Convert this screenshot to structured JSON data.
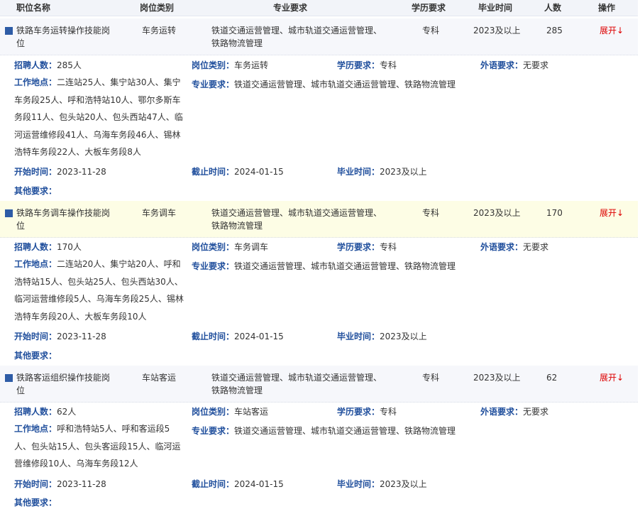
{
  "header": {
    "name": "职位名称",
    "category": "岗位类别",
    "major": "专业要求",
    "education": "学历要求",
    "graduation": "毕业时间",
    "count": "人数",
    "action": "操作"
  },
  "labels": {
    "recruit": "招聘人数",
    "category": "岗位类别",
    "education": "学历要求",
    "language": "外语要求",
    "location": "工作地点",
    "major": "专业要求",
    "start": "开始时间",
    "end": "截止时间",
    "graduation": "毕业时间",
    "other": "其他要求",
    "colon": "："
  },
  "jobs": [
    {
      "name": "铁路车务运转操作技能岗位",
      "category": "车务运转",
      "major_short": "铁道交通运营管理、城市轨道交通运营管理、铁路物流管理",
      "education": "专科",
      "graduation": "2023及以上",
      "count": "285",
      "action": "展开↓",
      "recruit": "285人",
      "language": "无要求",
      "location": "二连站25人、集宁站30人、集宁车务段25人、呼和浩特站10人、鄂尔多斯车务段11人、包头站20人、包头西站47人、临河运营维修段41人、乌海车务段46人、锡林浩特车务段22人、大板车务段8人",
      "major_full": "铁道交通运营管理、城市轨道交通运营管理、铁路物流管理",
      "start": "2023-11-28",
      "end": "2024-01-15",
      "grad_req": "2023及以上",
      "other": ""
    },
    {
      "name": "铁路车务调车操作技能岗位",
      "category": "车务调车",
      "major_short": "铁道交通运营管理、城市轨道交通运营管理、铁路物流管理",
      "education": "专科",
      "graduation": "2023及以上",
      "count": "170",
      "action": "展开↓",
      "recruit": "170人",
      "language": "无要求",
      "location": "二连站20人、集宁站20人、呼和浩特站15人、包头站25人、包头西站30人、临河运营维修段5人、乌海车务段25人、锡林浩特车务段20人、大板车务段10人",
      "major_full": "铁道交通运营管理、城市轨道交通运营管理、铁路物流管理",
      "start": "2023-11-28",
      "end": "2024-01-15",
      "grad_req": "2023及以上",
      "other": ""
    },
    {
      "name": "铁路客运组织操作技能岗位",
      "category": "车站客运",
      "major_short": "铁道交通运营管理、城市轨道交通运营管理、铁路物流管理",
      "education": "专科",
      "graduation": "2023及以上",
      "count": "62",
      "action": "展开↓",
      "recruit": "62人",
      "language": "无要求",
      "location": "呼和浩特站5人、呼和客运段5人、包头站15人、包头客运段15人、临河运营维修段10人、乌海车务段12人",
      "major_full": "铁道交通运营管理、城市轨道交通运营管理、铁路物流管理",
      "start": "2023-11-28",
      "end": "2024-01-15",
      "grad_req": "2023及以上",
      "other": ""
    }
  ]
}
